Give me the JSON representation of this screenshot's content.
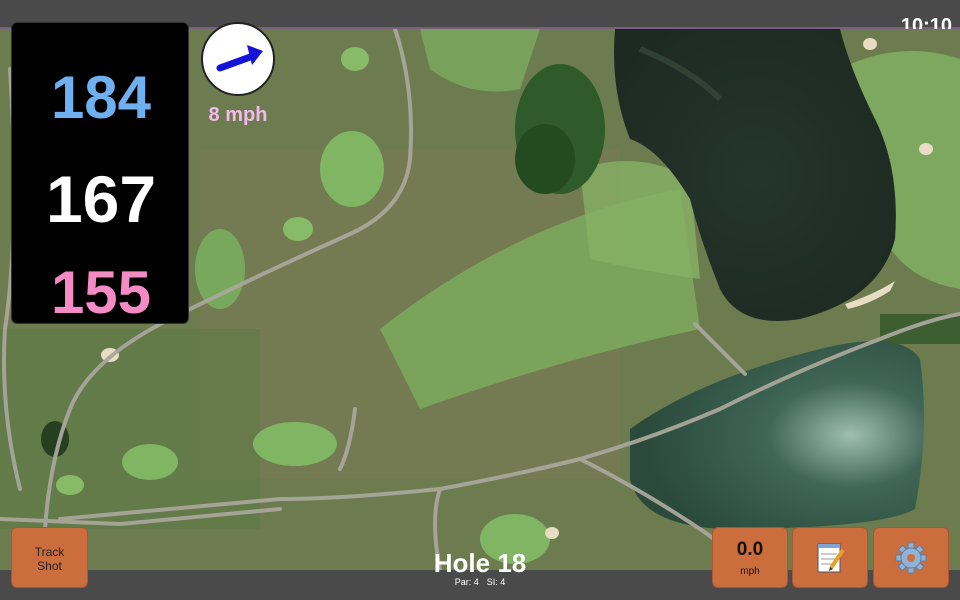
{
  "status_bar": {
    "time": "10:10"
  },
  "distances": {
    "back": "184",
    "center": "167",
    "front": "155"
  },
  "wind": {
    "speed_label": "8 mph",
    "direction_icon": "blue-arrow-icon"
  },
  "buttons": {
    "track_shot_line1": "Track",
    "track_shot_line2": "Shot",
    "speed_value": "0.0",
    "speed_unit": "mph",
    "notes_icon": "notepad-icon",
    "settings_icon": "gear-icon"
  },
  "hole": {
    "title": "Hole 18",
    "par": "Par: 4",
    "si": "SI: 4"
  },
  "colors": {
    "back": "#6fb0f0",
    "center": "#ffffff",
    "front": "#f58bc4",
    "wind_label": "#f3b8f0",
    "button": "#cc6d3e",
    "arrow": "#1414d8"
  }
}
